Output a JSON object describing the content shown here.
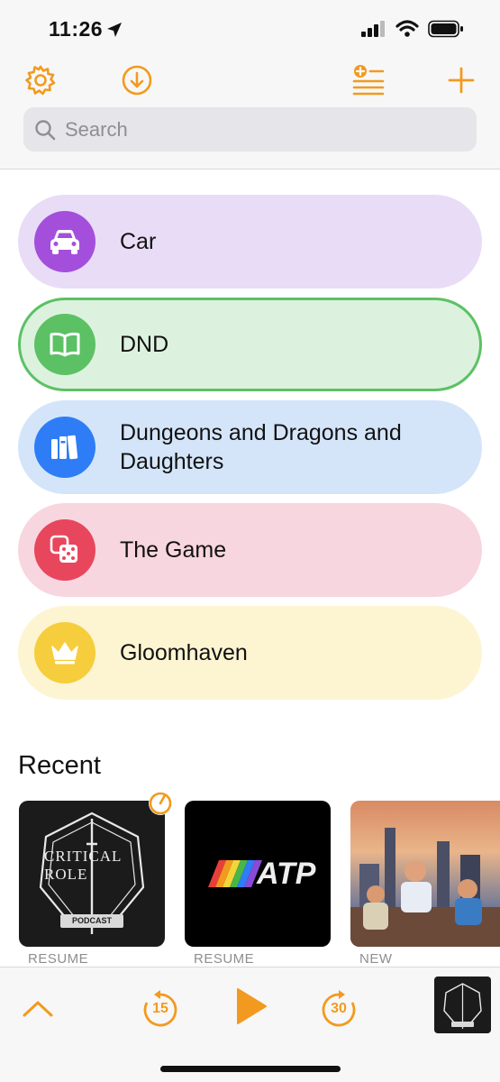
{
  "status": {
    "time": "11:26"
  },
  "toolbar": {
    "search_placeholder": "Search"
  },
  "folders": [
    {
      "label": "Car",
      "icon": "car-icon",
      "bg": "#e9dcf6",
      "accent": "#a44fdc"
    },
    {
      "label": "DND",
      "icon": "book-icon",
      "bg": "#dcf2de",
      "accent": "#5cc164",
      "selected": true
    },
    {
      "label": "Dungeons and Dragons and Daughters",
      "icon": "books-icon",
      "bg": "#d4e5fa",
      "accent": "#2f7df6"
    },
    {
      "label": "The Game",
      "icon": "dice-icon",
      "bg": "#f8d6df",
      "accent": "#e8465d"
    },
    {
      "label": "Gloomhaven",
      "icon": "crown-icon",
      "bg": "#fdf4d2",
      "accent": "#f6cd3c"
    }
  ],
  "recent": {
    "title": "Recent",
    "items": [
      {
        "status": "RESUME",
        "art_text": "CRITICAL ROLE",
        "art_badge": "PODCAST"
      },
      {
        "status": "RESUME",
        "art_text": "ATP"
      },
      {
        "status": "NEW"
      }
    ]
  },
  "player": {
    "skip_back": "15",
    "skip_forward": "30"
  },
  "colors": {
    "accent": "#f29a1f"
  }
}
